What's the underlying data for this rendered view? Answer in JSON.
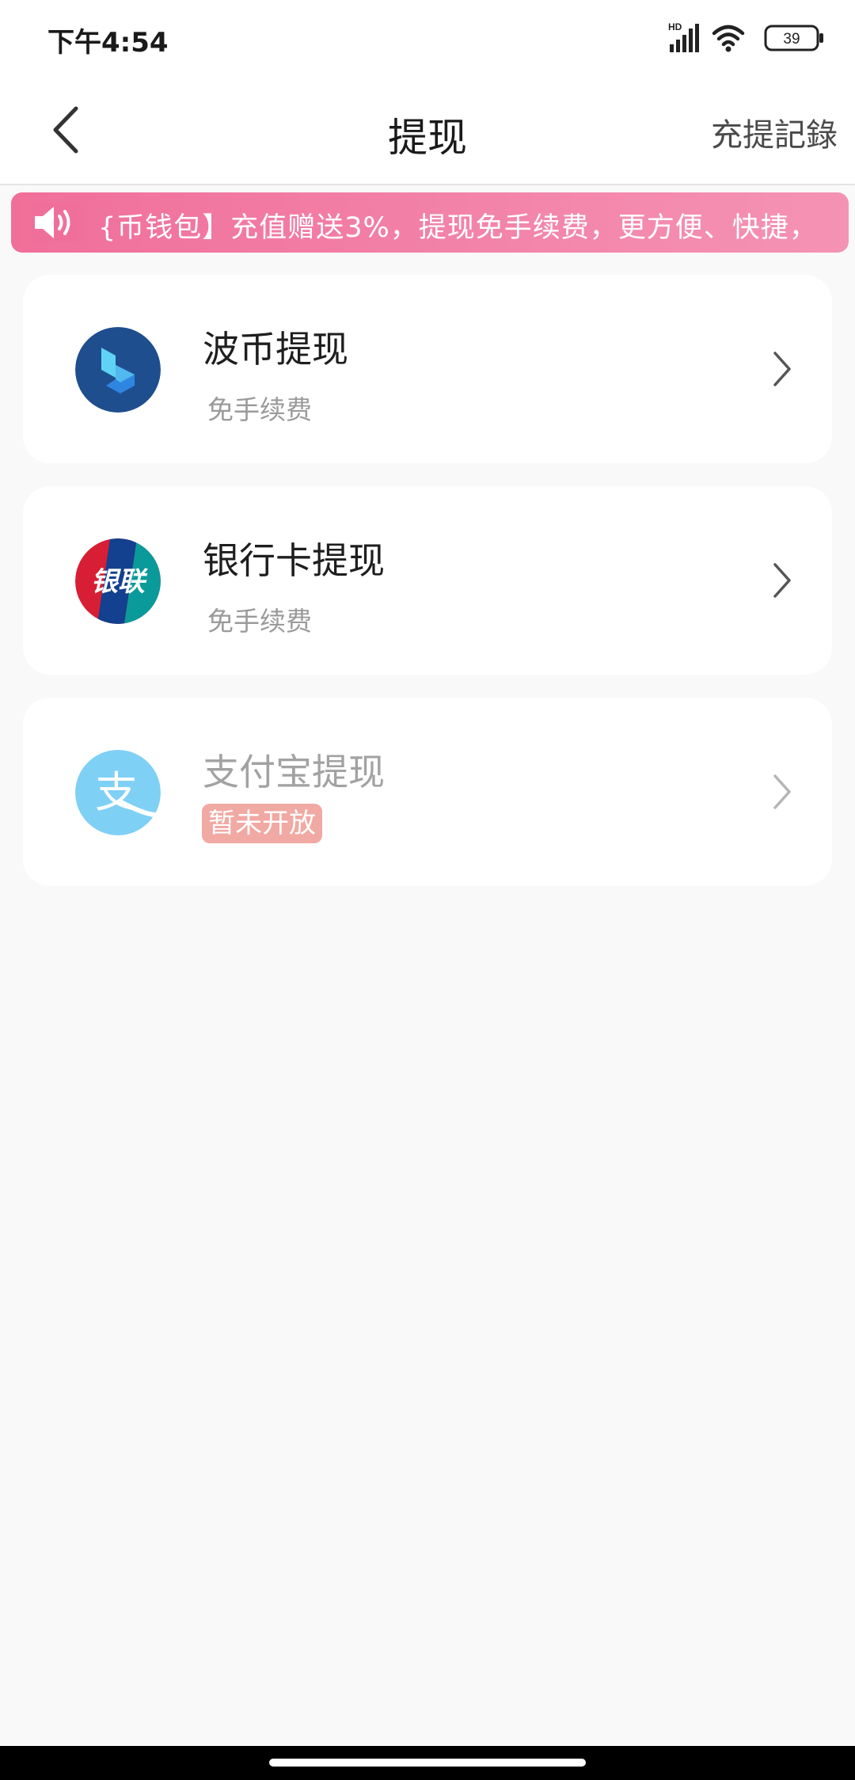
{
  "status_bar": {
    "time": "下午4:54",
    "network": "HD",
    "battery": "39"
  },
  "header": {
    "title": "提现",
    "action": "充提記錄",
    "back_icon": "chevron-left-icon"
  },
  "notice": {
    "icon": "speaker-icon",
    "text": "{币钱包】充值赠送3%，提现免手续费，更方便、快捷，"
  },
  "withdraw_options": [
    {
      "title": "波币提现",
      "subtitle": "免手续费",
      "icon": "bocoin-logo-icon",
      "enabled": true
    },
    {
      "title": "银行卡提现",
      "subtitle": "免手续费",
      "icon": "unionpay-logo-icon",
      "logo_text": "银联",
      "enabled": true
    },
    {
      "title": "支付宝提现",
      "badge": "暂未开放",
      "icon": "alipay-logo-icon",
      "logo_text": "支",
      "enabled": false
    }
  ],
  "colors": {
    "notice_gradient_start": "#f06f9a",
    "notice_gradient_end": "#f593b4",
    "badge": "#f1a9a3",
    "bocoin": "#1f4e8f",
    "alipay": "#7fd0f5"
  }
}
